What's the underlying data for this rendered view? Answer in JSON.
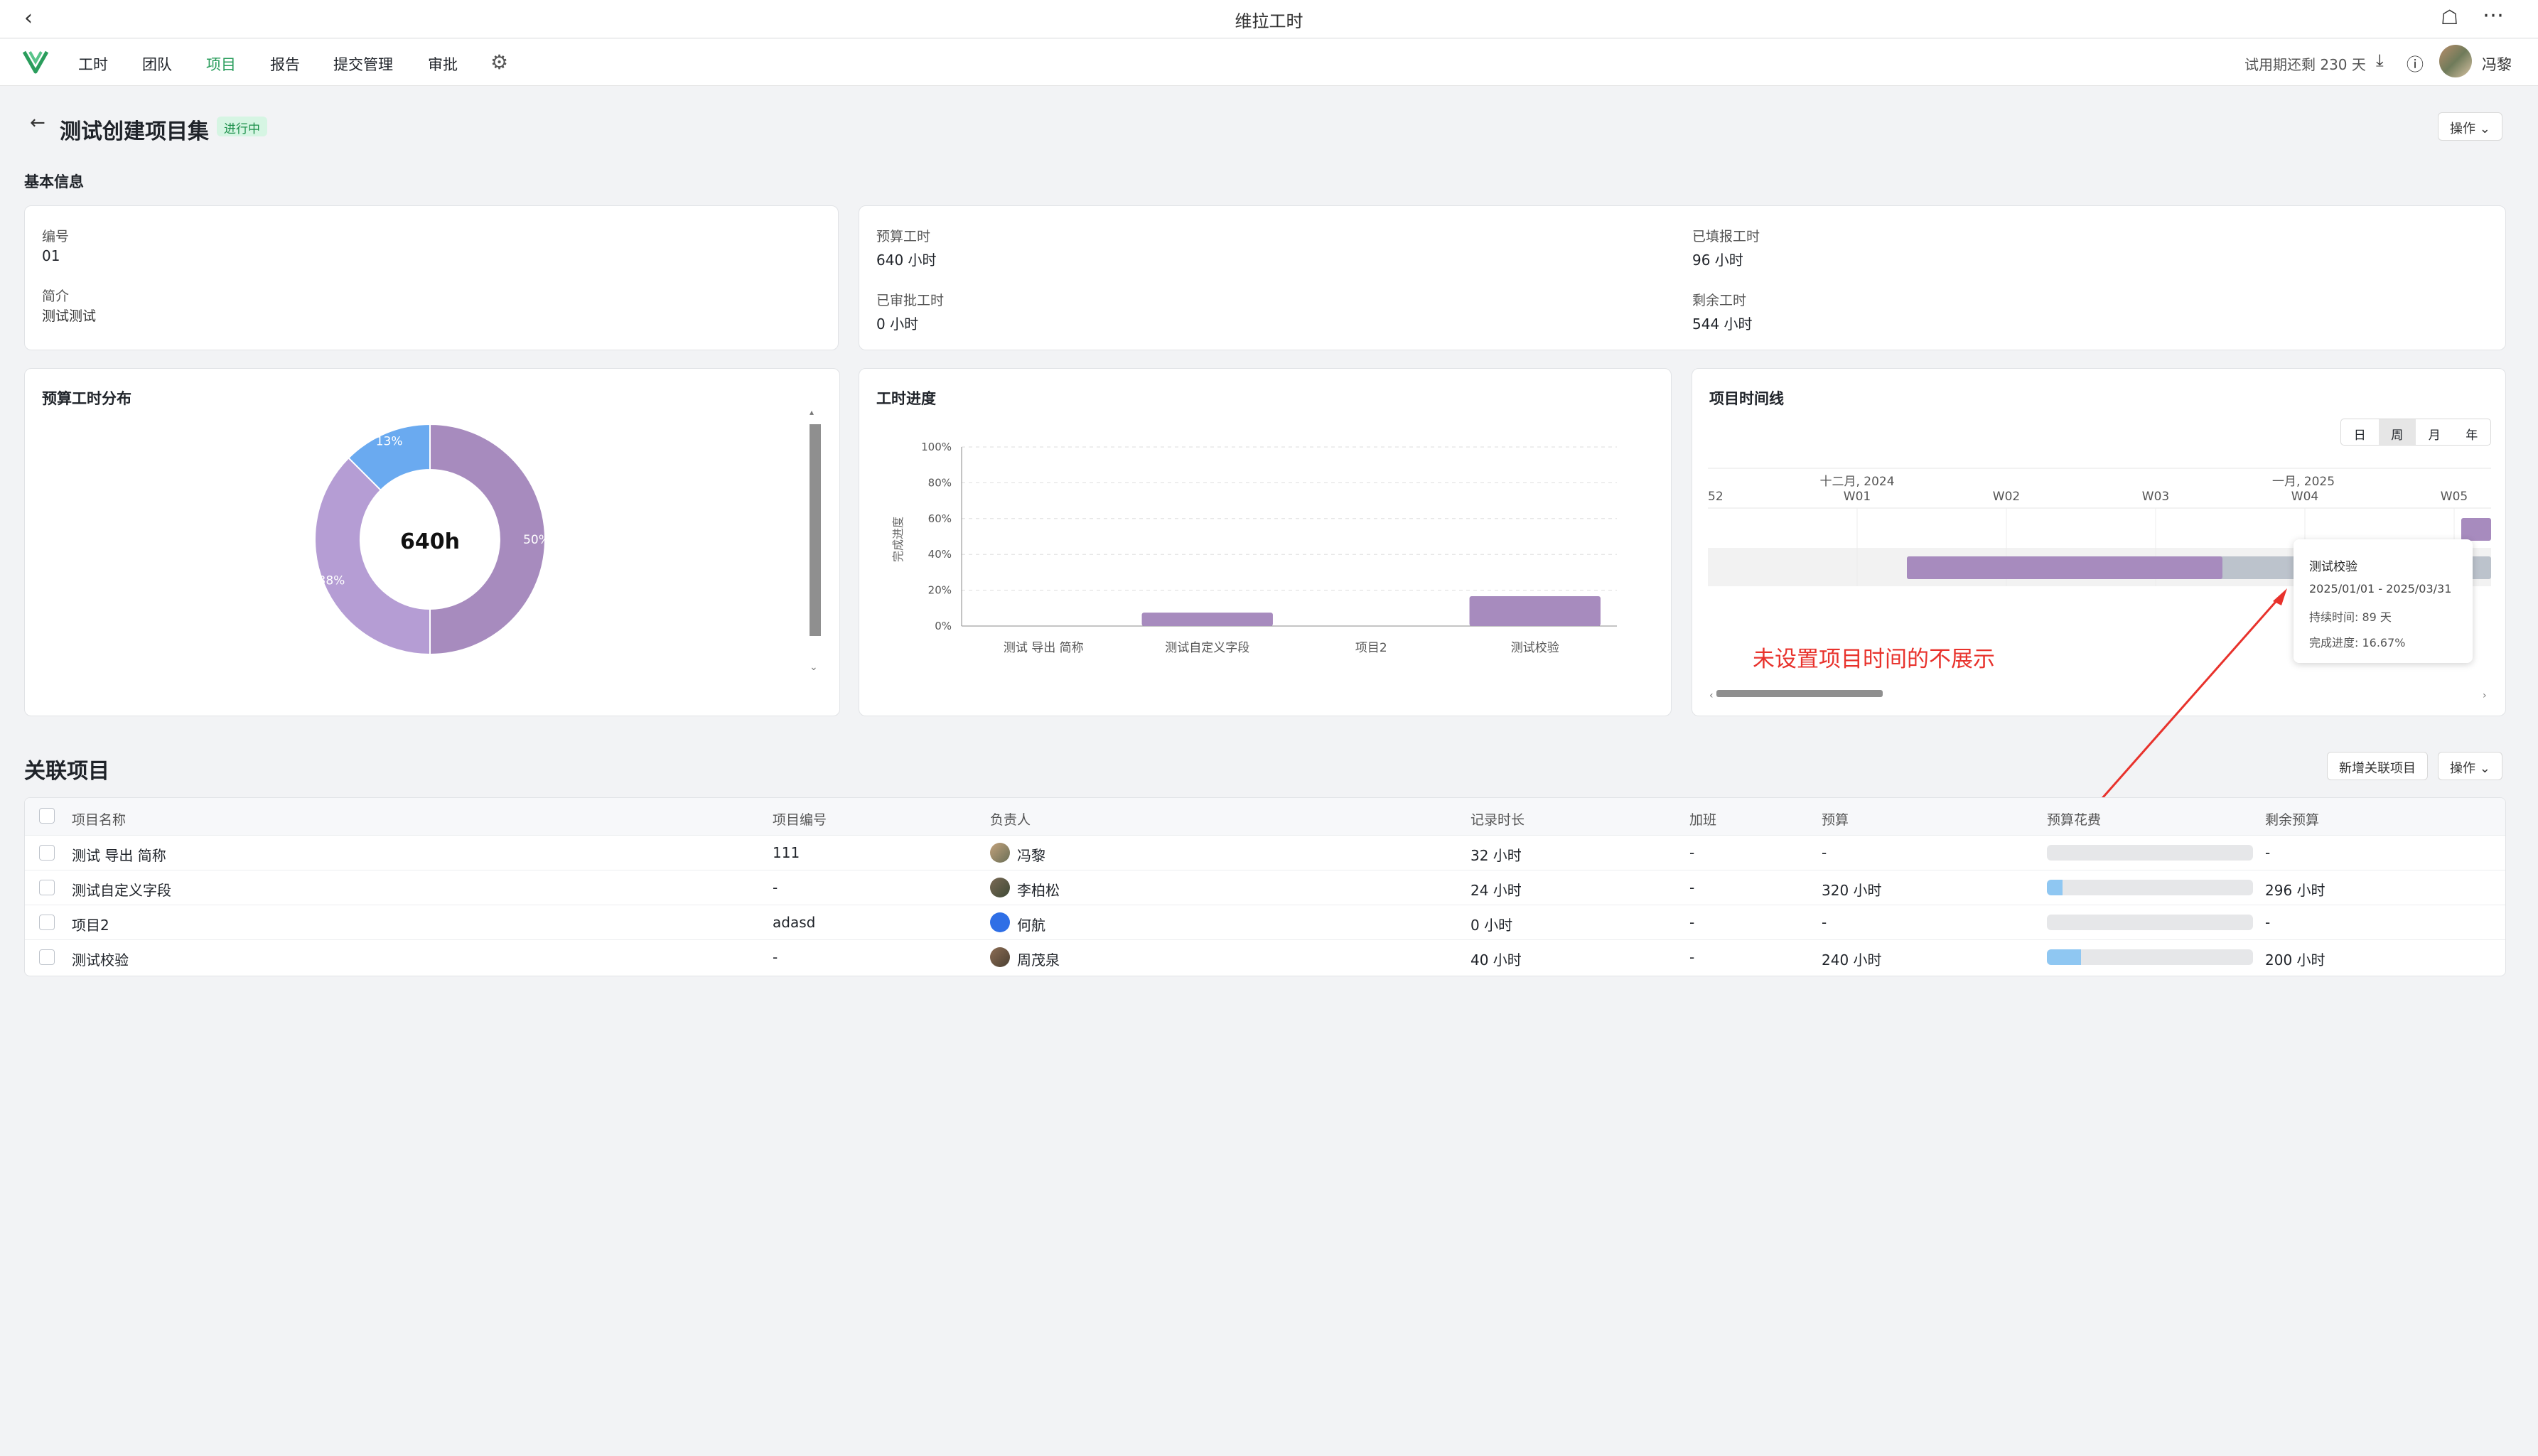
{
  "window": {
    "title": "维拉工时"
  },
  "nav": {
    "items": [
      "工时",
      "团队",
      "项目",
      "报告",
      "提交管理",
      "审批"
    ],
    "active": "项目",
    "trial": "试用期还剩 230 天",
    "user": "冯黎"
  },
  "header": {
    "title": "测试创建项目集",
    "status": "进行中",
    "ops": "操作"
  },
  "basic": {
    "section": "基本信息",
    "id_label": "编号",
    "id_value": "01",
    "desc_label": "简介",
    "desc_value": "测试测试",
    "budget_label": "预算工时",
    "budget_value": "640 小时",
    "filled_label": "已填报工时",
    "filled_value": "96 小时",
    "approved_label": "已审批工时",
    "approved_value": "0 小时",
    "remain_label": "剩余工时",
    "remain_value": "544 小时"
  },
  "donut": {
    "title": "预算工时分布",
    "center": "640h",
    "labels": [
      "50%",
      "38%",
      "13%"
    ],
    "colors": [
      "#a78bbe",
      "#b59dd4",
      "#6aaaf0"
    ]
  },
  "chart_data": {
    "type": "bar",
    "title": "工时进度",
    "ylabel": "完成进度",
    "categories": [
      "测试 导出 简称",
      "测试自定义字段",
      "项目2",
      "测试校验"
    ],
    "values": [
      0,
      7.5,
      0,
      16.67
    ],
    "ylim": [
      0,
      100
    ],
    "yticks": [
      "0%",
      "20%",
      "40%",
      "60%",
      "80%",
      "100%"
    ],
    "grid": true,
    "color": "#a78bbe"
  },
  "timeline": {
    "title": "项目时间线",
    "views": [
      "日",
      "周",
      "月",
      "年"
    ],
    "active_view": "周",
    "months": [
      "十二月, 2024",
      "一月, 2025"
    ],
    "weeks": [
      "52",
      "W01",
      "W02",
      "W03",
      "W04",
      "W05"
    ],
    "tooltip": {
      "name": "测试校验",
      "range": "2025/01/01 - 2025/03/31",
      "duration": "持续时间:  89 天",
      "progress": "完成进度:  16.67%"
    },
    "annotation": "未设置项目时间的不展示"
  },
  "related": {
    "title": "关联项目",
    "add_button": "新增关联项目",
    "ops": "操作",
    "columns": [
      "项目名称",
      "项目编号",
      "负责人",
      "记录时长",
      "加班",
      "预算",
      "预算花费",
      "剩余预算"
    ],
    "rows": [
      {
        "name": "测试 导出 简称",
        "code": "111",
        "owner": "冯黎",
        "hours": "32 小时",
        "overtime": "-",
        "budget": "-",
        "spent": 0,
        "remain": "-"
      },
      {
        "name": "测试自定义字段",
        "code": "-",
        "owner": "李柏松",
        "hours": "24 小时",
        "overtime": "-",
        "budget": "320 小时",
        "spent": 0.075,
        "remain": "296 小时"
      },
      {
        "name": "项目2",
        "code": "adasd",
        "owner": "何航",
        "owner_initials": "何航",
        "hours": "0 小时",
        "overtime": "-",
        "budget": "-",
        "spent": 0,
        "remain": "-"
      },
      {
        "name": "测试校验",
        "code": "-",
        "owner": "周茂泉",
        "hours": "40 小时",
        "overtime": "-",
        "budget": "240 小时",
        "spent": 0.1667,
        "remain": "200 小时"
      }
    ]
  }
}
